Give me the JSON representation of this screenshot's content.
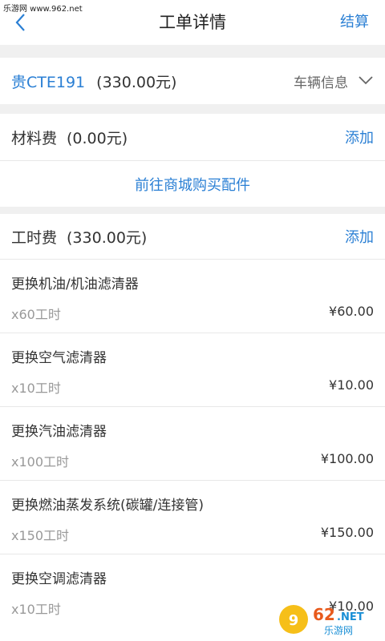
{
  "watermark": {
    "top": "乐游网 www.962.net",
    "logo": "962 乐游网"
  },
  "navbar": {
    "title": "工单详情",
    "action": "结算"
  },
  "vehicle": {
    "plate": "贵CTE191",
    "amount": "(330.00元)",
    "toggle": "车辆信息"
  },
  "materials": {
    "title": "材料费",
    "amount": "(0.00元)",
    "add": "添加",
    "shop_link": "前往商城购买配件"
  },
  "labor": {
    "title": "工时费",
    "amount": "(330.00元)",
    "add": "添加",
    "items": [
      {
        "name": "更换机油/机油滤清器",
        "hours": "x60工时",
        "price": "¥60.00"
      },
      {
        "name": "更换空气滤清器",
        "hours": "x10工时",
        "price": "¥10.00"
      },
      {
        "name": "更换汽油滤清器",
        "hours": "x100工时",
        "price": "¥100.00"
      },
      {
        "name": "更换燃油蒸发系统(碳罐/连接管)",
        "hours": "x150工时",
        "price": "¥150.00"
      },
      {
        "name": "更换空调滤清器",
        "hours": "x10工时",
        "price": "¥10.00"
      }
    ]
  },
  "colors": {
    "accent": "#2a7fd4",
    "background": "#f0f0f0",
    "muted": "#999999"
  }
}
